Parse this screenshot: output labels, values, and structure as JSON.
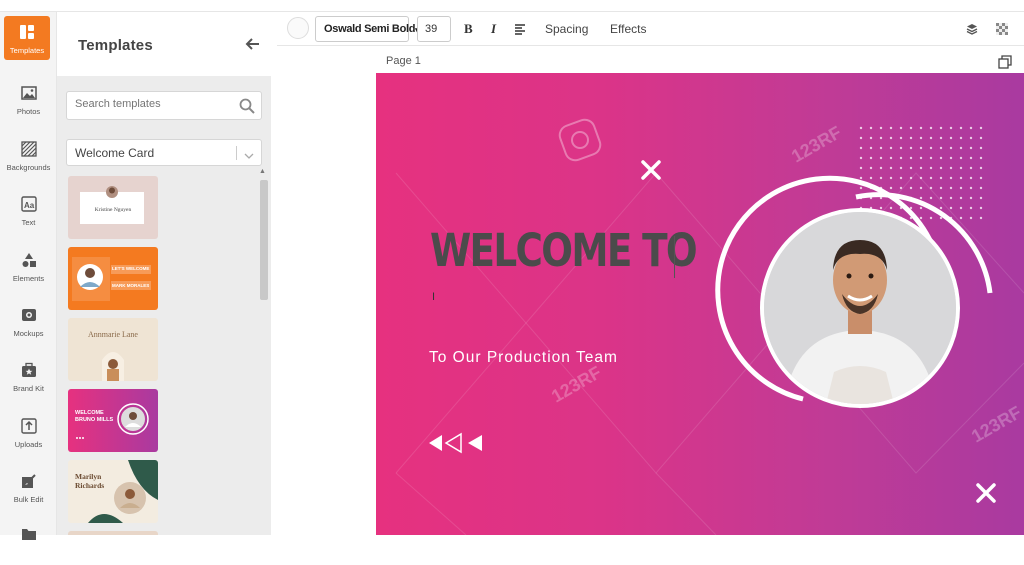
{
  "rail": [
    {
      "label": "Templates",
      "icon": "templates-icon",
      "active": true
    },
    {
      "label": "Photos",
      "icon": "photos-icon"
    },
    {
      "label": "Backgrounds",
      "icon": "backgrounds-icon"
    },
    {
      "label": "Text",
      "icon": "text-icon"
    },
    {
      "label": "Elements",
      "icon": "elements-icon"
    },
    {
      "label": "Mockups",
      "icon": "mockups-icon"
    },
    {
      "label": "Brand Kit",
      "icon": "brand-kit-icon"
    },
    {
      "label": "Uploads",
      "icon": "uploads-icon"
    },
    {
      "label": "Bulk Edit",
      "icon": "bulk-edit-icon"
    }
  ],
  "panel": {
    "title": "Templates",
    "search_placeholder": "Search templates",
    "category": "Welcome Card",
    "thumbnails": [
      {
        "name": "Kristine Nguyen"
      },
      {
        "line1": "LET'S WELCOME",
        "line2": "MARK MORALES"
      },
      {
        "name": "Annmarie Lane"
      },
      {
        "line1": "WELCOME",
        "line2": "BRUNO MILLS"
      },
      {
        "line1": "Marilyn",
        "line2": "Richards"
      }
    ]
  },
  "toolbar": {
    "font": "Oswald Semi Bold",
    "size": "39",
    "bold": "B",
    "italic": "I",
    "spacing": "Spacing",
    "effects": "Effects"
  },
  "canvas": {
    "page_label": "Page 1",
    "headline": "WELCOME TO",
    "subline": "To Our Production Team",
    "watermark": "123RF",
    "colors": {
      "gradient_start": "#e6317f",
      "gradient_end": "#a93aa0"
    }
  },
  "accent": "#f37a21"
}
